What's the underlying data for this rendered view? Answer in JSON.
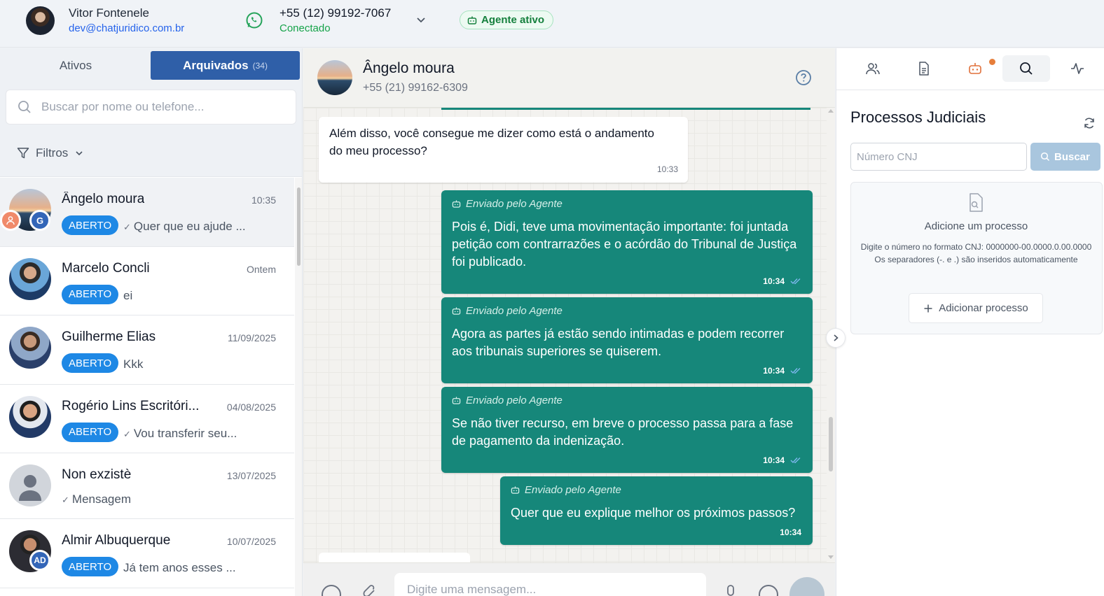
{
  "topbar": {
    "user_name": "Vitor Fontenele",
    "user_email": "dev@chatjuridico.com.br",
    "phone": "+55 (12) 99192-7067",
    "connection_status": "Conectado",
    "agent_badge": "Agente ativo"
  },
  "left": {
    "tabs": {
      "active_label": "Ativos",
      "archived_label": "Arquivados",
      "archived_count": "(34)"
    },
    "search_placeholder": "Buscar por nome ou telefone...",
    "filters_label": "Filtros",
    "chats": [
      {
        "name": "Ângelo moura",
        "time": "10:35",
        "status": "ABERTO",
        "preview": "Quer que eu ajude ...",
        "check": "✓"
      },
      {
        "name": "Marcelo Concli",
        "time": "Ontem",
        "status": "ABERTO",
        "preview": "ei",
        "check": ""
      },
      {
        "name": "Guilherme Elias",
        "time": "11/09/2025",
        "status": "ABERTO",
        "preview": "Kkk",
        "check": ""
      },
      {
        "name": "Rogério Lins Escritóri...",
        "time": "04/08/2025",
        "status": "ABERTO",
        "preview": "Vou transferir seu...",
        "check": "✓"
      },
      {
        "name": "Non exzistè",
        "time": "13/07/2025",
        "status": "",
        "preview": "Mensagem",
        "check": "✓"
      },
      {
        "name": "Almir Albuquerque",
        "time": "10/07/2025",
        "status": "ABERTO",
        "preview": "Já tem anos esses ...",
        "check": ""
      }
    ],
    "mini_avatars": {
      "g": "G",
      "ad": "AD"
    }
  },
  "conversation": {
    "contact_name": "Ângelo moura",
    "contact_phone": "+55 (21) 99162-6309",
    "incoming": {
      "text": "Além disso, você consegue me dizer como está o andamento do meu processo?",
      "time": "10:33"
    },
    "agent_label": "Enviado pelo Agente",
    "outgoing": [
      {
        "text": "Pois é, Didi, teve uma movimentação importante: foi juntada petição com contrarrazões e o acórdão do Tribunal de Justiça foi publicado.",
        "time": "10:34"
      },
      {
        "text": "Agora as partes já estão sendo intimadas e podem recorrer aos tribunais superiores se quiserem.",
        "time": "10:34"
      },
      {
        "text": "Se não tiver recurso, em breve o processo passa para a fase de pagamento da indenização.",
        "time": "10:34"
      },
      {
        "text": "Quer que eu explique melhor os próximos passos?",
        "time": "10:34"
      }
    ],
    "composer_placeholder": "Digite uma mensagem..."
  },
  "right": {
    "title": "Processos Judiciais",
    "cnj_placeholder": "Número CNJ",
    "search_button": "Buscar",
    "empty_title": "Adicione um processo",
    "empty_desc_1": "Digite o número no formato CNJ: 0000000-00.0000.0.00.0000",
    "empty_desc_2": "Os separadores (-. e .) são inseridos automaticamente",
    "add_button": "Adicionar processo"
  },
  "colors": {
    "accent_blue": "#2f5fa8",
    "status_badge": "#1e88e5",
    "agent_message": "#16877a",
    "connected_green": "#16a34a",
    "notification_dot": "#e67e3a"
  }
}
